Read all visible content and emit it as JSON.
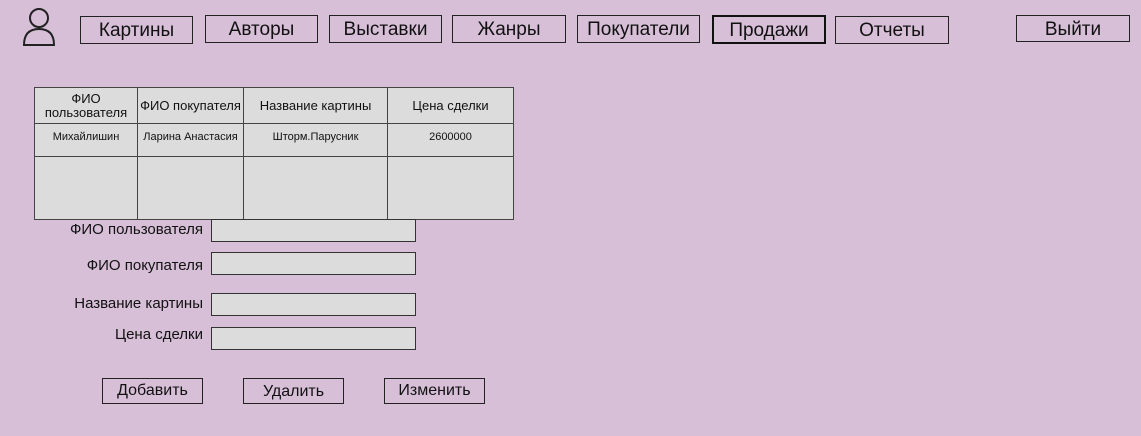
{
  "nav": {
    "items": [
      {
        "label": "Картины"
      },
      {
        "label": "Авторы"
      },
      {
        "label": "Выставки"
      },
      {
        "label": "Жанры"
      },
      {
        "label": "Покупатели"
      },
      {
        "label": "Продажи",
        "active": true
      },
      {
        "label": "Отчеты"
      }
    ],
    "logout_label": "Выйти",
    "user_icon": "user-icon"
  },
  "table": {
    "headers": [
      "ФИО пользователя",
      "ФИО покупателя",
      "Название картины",
      "Цена сделки"
    ],
    "rows": [
      [
        "Михайлишин",
        "Ларина Анастасия",
        "Шторм.Парусник",
        "2600000"
      ],
      [
        "",
        "",
        "",
        ""
      ]
    ]
  },
  "form": {
    "user_label": "ФИО пользователя",
    "buyer_label": "ФИО покупателя",
    "painting_label": "Название картины",
    "price_label": "Цена сделки",
    "user_value": "",
    "buyer_value": "",
    "painting_value": "",
    "price_value": ""
  },
  "actions": {
    "add_label": "Добавить",
    "delete_label": "Удалить",
    "edit_label": "Изменить"
  },
  "colors": {
    "background": "#d8bfd8",
    "table_fill": "#dcdcdc"
  }
}
